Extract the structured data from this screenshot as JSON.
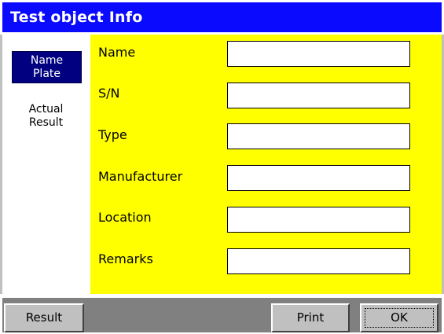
{
  "window": {
    "title": "Test object Info"
  },
  "sidebar": {
    "items": [
      {
        "label": "Name\nPlate",
        "active": true
      },
      {
        "label": "Actual\nResult",
        "active": false
      }
    ]
  },
  "form": {
    "fields": [
      {
        "label": "Name",
        "value": ""
      },
      {
        "label": "S/N",
        "value": ""
      },
      {
        "label": "Type",
        "value": ""
      },
      {
        "label": "Manufacturer",
        "value": ""
      },
      {
        "label": "Location",
        "value": ""
      },
      {
        "label": "Remarks",
        "value": ""
      }
    ]
  },
  "footer": {
    "result_label": "Result",
    "print_label": "Print",
    "ok_label": "OK"
  },
  "colors": {
    "title_bar": "#0a0aff",
    "form_background": "#ffff00",
    "active_nav": "#000080",
    "button_face": "#c0c0c0",
    "footer_strip": "#808080"
  }
}
